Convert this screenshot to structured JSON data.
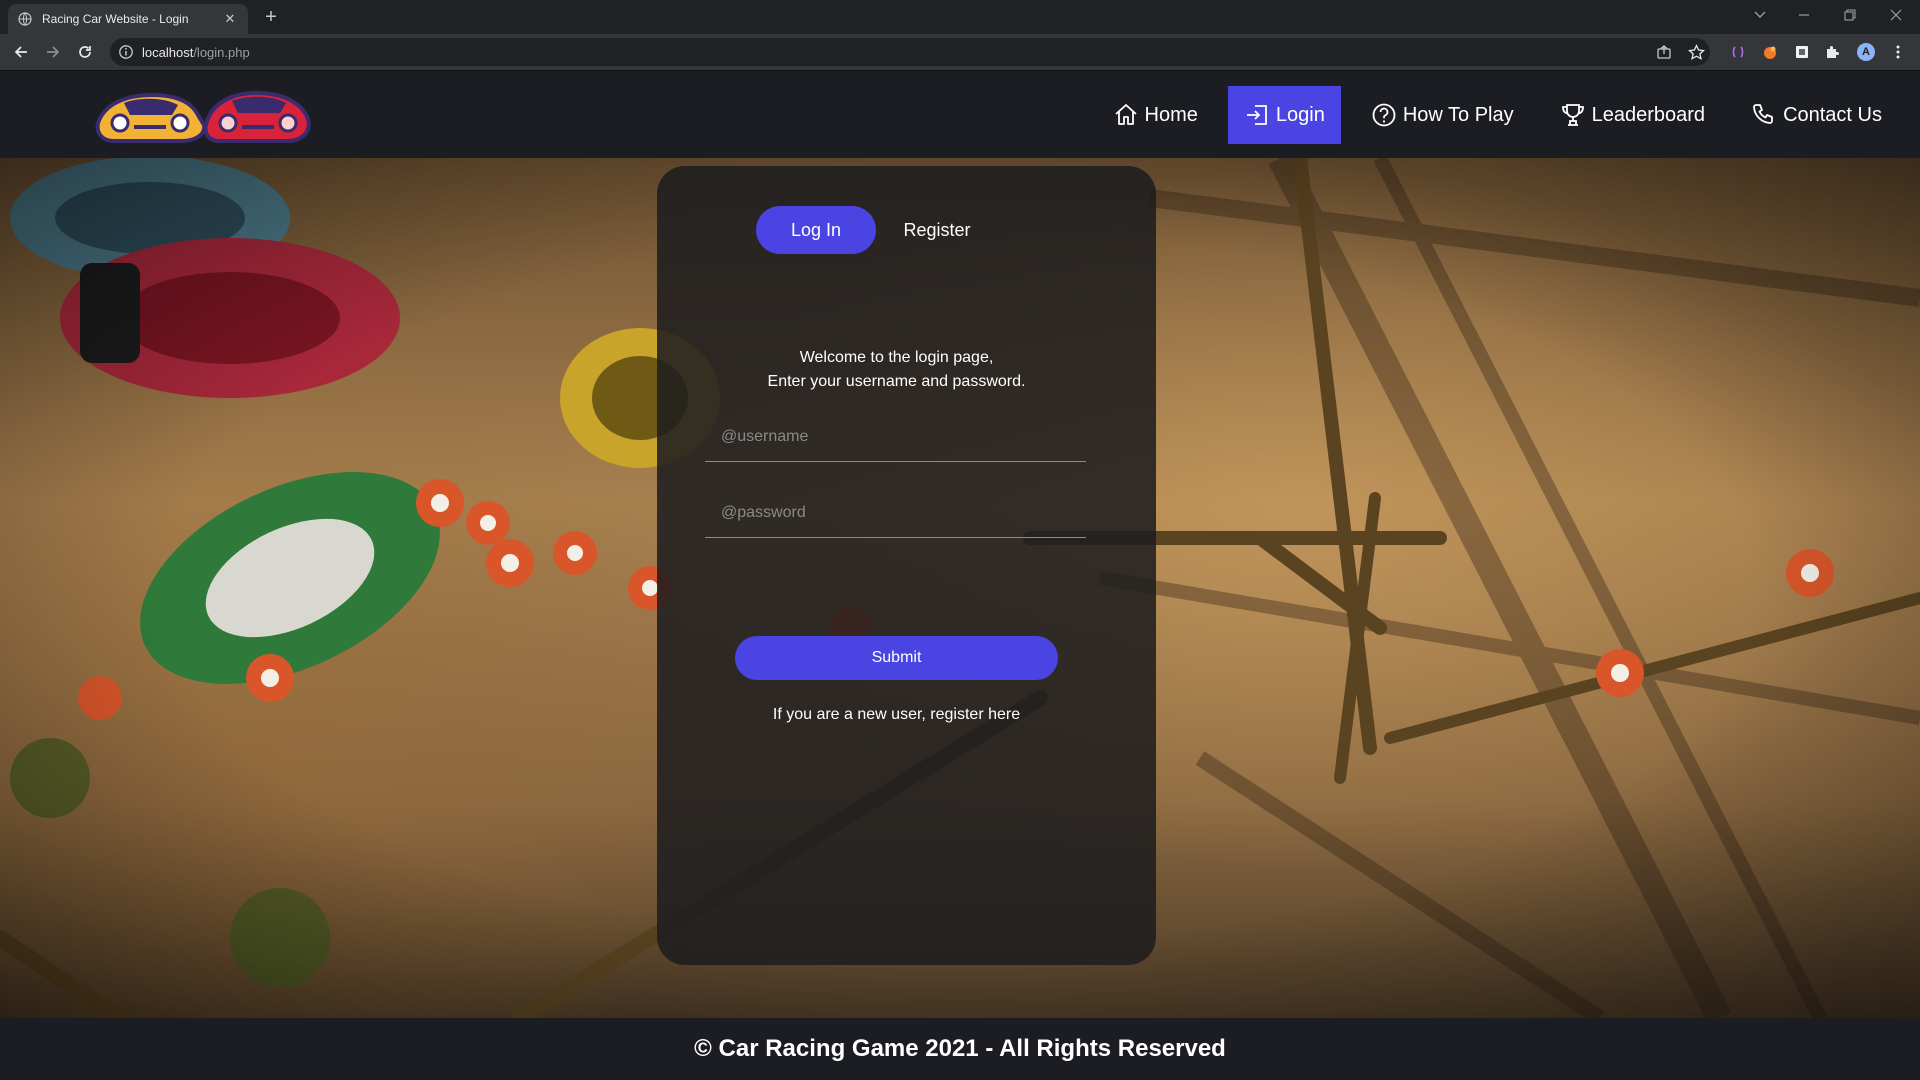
{
  "browser": {
    "tab_title": "Racing Car Website - Login",
    "tab_close": "✕",
    "new_tab": "+",
    "url_host": "localhost",
    "url_path": "/login.php",
    "profile_initial": "A"
  },
  "site": {
    "nav": [
      {
        "label": "Home",
        "icon": "home-icon"
      },
      {
        "label": "Login",
        "icon": "login-icon",
        "active": true
      },
      {
        "label": "How To Play",
        "icon": "question-circle-icon"
      },
      {
        "label": "Leaderboard",
        "icon": "trophy-icon"
      },
      {
        "label": "Contact Us",
        "icon": "phone-icon"
      }
    ],
    "accent_color": "#4a44e2"
  },
  "login": {
    "tab_login": "Log In",
    "tab_register": "Register",
    "welcome_line1": "Welcome to the login page,",
    "welcome_line2": "Enter your username and password.",
    "username_placeholder": "@username",
    "password_placeholder": "@password",
    "submit_label": "Submit",
    "register_text": "If you are a new user, register here"
  },
  "footer": {
    "text": "© Car Racing Game 2021 - All Rights Reserved"
  }
}
